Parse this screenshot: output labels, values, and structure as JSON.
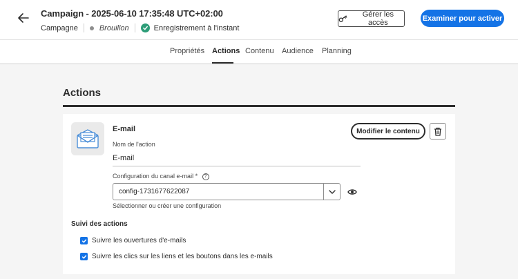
{
  "header": {
    "title": "Campaign - 2025-06-10 17:35:48 UTC+02:00",
    "type_label": "Campagne",
    "status": "Brouillon",
    "save_status": "Enregistrement à l'instant",
    "manage_access_label": "Gérer les accès",
    "review_label": "Examiner pour activer"
  },
  "tabs": [
    {
      "label": "Propriétés"
    },
    {
      "label": "Actions"
    },
    {
      "label": "Contenu"
    },
    {
      "label": "Audience"
    },
    {
      "label": "Planning"
    }
  ],
  "active_tab": "Actions",
  "section": {
    "title": "Actions"
  },
  "action": {
    "channel_title": "E-mail",
    "name_label": "Nom de l'action",
    "name_value": "E-mail",
    "config_label": "Configuration du canal e-mail",
    "required_mark": "*",
    "config_value": "config-1731677622087",
    "config_hint": "Sélectionner ou créer une configuration",
    "modify_label": "Modifier le contenu"
  },
  "tracking": {
    "title": "Suivi des actions",
    "options": [
      {
        "label": "Suivre les ouvertures d'e-mails",
        "checked": true
      },
      {
        "label": "Suivre les clics sur les liens et les boutons dans les e-mails",
        "checked": true
      }
    ]
  },
  "colors": {
    "accent": "#1473e6",
    "success": "#2d9d78",
    "background": "#f5f5f5"
  },
  "icons": [
    "arrow-left-icon",
    "success-check-icon",
    "key-icon",
    "email-envelope-icon",
    "help-icon",
    "chevron-down-icon",
    "eye-icon",
    "trash-icon",
    "checkbox-checked-icon"
  ]
}
